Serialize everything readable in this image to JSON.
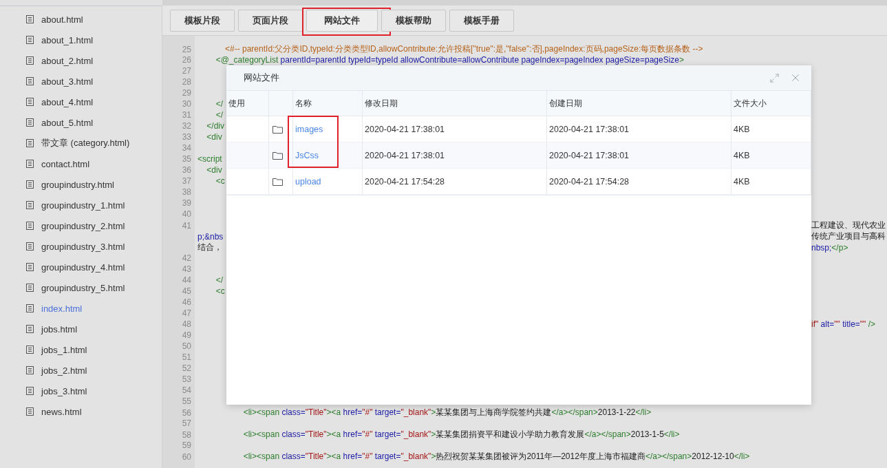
{
  "sidebar": {
    "items": [
      {
        "label": "about.html",
        "selected": false
      },
      {
        "label": "about_1.html",
        "selected": false
      },
      {
        "label": "about_2.html",
        "selected": false
      },
      {
        "label": "about_3.html",
        "selected": false
      },
      {
        "label": "about_4.html",
        "selected": false
      },
      {
        "label": "about_5.html",
        "selected": false
      },
      {
        "label": "带文章 (category.html)",
        "selected": false
      },
      {
        "label": "contact.html",
        "selected": false
      },
      {
        "label": "groupindustry.html",
        "selected": false
      },
      {
        "label": "groupindustry_1.html",
        "selected": false
      },
      {
        "label": "groupindustry_2.html",
        "selected": false
      },
      {
        "label": "groupindustry_3.html",
        "selected": false
      },
      {
        "label": "groupindustry_4.html",
        "selected": false
      },
      {
        "label": "groupindustry_5.html",
        "selected": false
      },
      {
        "label": "index.html",
        "selected": true
      },
      {
        "label": "jobs.html",
        "selected": false
      },
      {
        "label": "jobs_1.html",
        "selected": false
      },
      {
        "label": "jobs_2.html",
        "selected": false
      },
      {
        "label": "jobs_3.html",
        "selected": false
      },
      {
        "label": "news.html",
        "selected": false
      }
    ]
  },
  "toolbar": {
    "buttons": [
      {
        "label": "模板片段",
        "selected": false,
        "outlined": false
      },
      {
        "label": "页面片段",
        "selected": false,
        "outlined": false
      },
      {
        "label": "网站文件",
        "selected": true,
        "outlined": true
      },
      {
        "label": "模板帮助",
        "selected": false,
        "outlined": false
      },
      {
        "label": "模板手册",
        "selected": false,
        "outlined": false
      }
    ]
  },
  "editor": {
    "lines": [
      {
        "number": "25",
        "full": true,
        "segments": [
          {
            "kind": "comment",
            "text": "            <#-- parentId:父分类ID,typeId:分类类型ID,allowContribute:允许投稿[\"true\":是,\"false\":否],pageIndex:页码,pageSize:每页数据条数 -->"
          }
        ]
      },
      {
        "number": "26",
        "full": true,
        "segments": [
          {
            "kind": "tag",
            "text": "        <@_categoryList"
          },
          {
            "kind": "attr",
            "text": " parentId=parentId typeId=typeId allowContribute=allowContribute pageIndex=pageIndex pageSize=pageSize"
          },
          {
            "kind": "tag",
            "text": ">"
          }
        ]
      },
      {
        "number": "27"
      },
      {
        "number": "28"
      },
      {
        "number": "29"
      },
      {
        "number": "30",
        "segments": [
          {
            "kind": "tag",
            "text": "        </"
          }
        ]
      },
      {
        "number": "31",
        "segments": [
          {
            "kind": "tag",
            "text": "        </"
          }
        ]
      },
      {
        "number": "32",
        "segments": [
          {
            "kind": "tag",
            "text": "    </div"
          }
        ]
      },
      {
        "number": "33",
        "segments": [
          {
            "kind": "tag",
            "text": "    <div"
          }
        ]
      },
      {
        "number": "34"
      },
      {
        "number": "35",
        "segments": [
          {
            "kind": "tag",
            "text": "<script"
          }
        ]
      },
      {
        "number": "36",
        "segments": [
          {
            "kind": "tag",
            "text": "    <div"
          }
        ]
      },
      {
        "number": "37",
        "segments": [
          {
            "kind": "tag",
            "text": "        <c"
          }
        ]
      },
      {
        "number": "38"
      },
      {
        "number": "39"
      },
      {
        "number": "40"
      },
      {
        "number": "41",
        "tail": [
          {
            "kind": "text",
            "text": "工程建设、现代农业"
          }
        ]
      },
      {
        "segments": [
          {
            "kind": "attr",
            "text": "p;&nbs"
          }
        ],
        "tail": [
          {
            "kind": "text",
            "text": "传统产业项目与高科"
          }
        ]
      },
      {
        "segments": [
          {
            "kind": "text",
            "text": "结合，"
          }
        ],
        "tail": [
          {
            "kind": "attr",
            "text": "nbsp;"
          },
          {
            "kind": "tag",
            "text": "</p>"
          }
        ]
      },
      {
        "number": "42"
      },
      {
        "number": "43"
      },
      {
        "number": "44",
        "segments": [
          {
            "kind": "tag",
            "text": "        </"
          }
        ]
      },
      {
        "number": "45",
        "segments": [
          {
            "kind": "tag",
            "text": "        <c"
          }
        ]
      },
      {
        "number": "46"
      },
      {
        "number": "47"
      },
      {
        "number": "48",
        "tail": [
          {
            "kind": "value",
            "text": "if\""
          },
          {
            "kind": "attr",
            "text": " alt="
          },
          {
            "kind": "value",
            "text": "\"\""
          },
          {
            "kind": "attr",
            "text": " title="
          },
          {
            "kind": "value",
            "text": "\"\""
          },
          {
            "kind": "tag",
            "text": " />"
          }
        ]
      },
      {
        "number": "49"
      },
      {
        "number": "50"
      },
      {
        "number": "51"
      },
      {
        "number": "52"
      },
      {
        "number": "53"
      },
      {
        "number": "54"
      },
      {
        "number": "55"
      },
      {
        "number": "56",
        "full": true,
        "segments": [
          {
            "kind": "tag",
            "text": "                    <li><span"
          },
          {
            "kind": "attr",
            "text": " class="
          },
          {
            "kind": "value",
            "text": "\"Title\""
          },
          {
            "kind": "tag",
            "text": "><a"
          },
          {
            "kind": "attr",
            "text": " href="
          },
          {
            "kind": "value",
            "text": "\"#\""
          },
          {
            "kind": "attr",
            "text": " target="
          },
          {
            "kind": "value",
            "text": "\"_blank\""
          },
          {
            "kind": "tag",
            "text": ">"
          },
          {
            "kind": "text",
            "text": "某某集团与上海商学院签约共建"
          },
          {
            "kind": "tag",
            "text": "</a></span>"
          },
          {
            "kind": "text",
            "text": "2013-1-22"
          },
          {
            "kind": "tag",
            "text": "</li>"
          }
        ]
      },
      {
        "number": "57"
      },
      {
        "number": "58",
        "full": true,
        "segments": [
          {
            "kind": "tag",
            "text": "                    <li><span"
          },
          {
            "kind": "attr",
            "text": " class="
          },
          {
            "kind": "value",
            "text": "\"Title\""
          },
          {
            "kind": "tag",
            "text": "><a"
          },
          {
            "kind": "attr",
            "text": " href="
          },
          {
            "kind": "value",
            "text": "\"#\""
          },
          {
            "kind": "attr",
            "text": " target="
          },
          {
            "kind": "value",
            "text": "\"_blank\""
          },
          {
            "kind": "tag",
            "text": ">"
          },
          {
            "kind": "text",
            "text": "某某集团捐资平和建设小学助力教育发展"
          },
          {
            "kind": "tag",
            "text": "</a></span>"
          },
          {
            "kind": "text",
            "text": "2013-1-5"
          },
          {
            "kind": "tag",
            "text": "</li>"
          }
        ]
      },
      {
        "number": "59"
      },
      {
        "number": "60",
        "full": true,
        "segments": [
          {
            "kind": "tag",
            "text": "                    <li><span"
          },
          {
            "kind": "attr",
            "text": " class="
          },
          {
            "kind": "value",
            "text": "\"Title\""
          },
          {
            "kind": "tag",
            "text": "><a"
          },
          {
            "kind": "attr",
            "text": " href="
          },
          {
            "kind": "value",
            "text": "\"#\""
          },
          {
            "kind": "attr",
            "text": " target="
          },
          {
            "kind": "value",
            "text": "\"_blank\""
          },
          {
            "kind": "tag",
            "text": ">"
          },
          {
            "kind": "text",
            "text": "热烈祝贺某某集团被评为2011年—2012年度上海市福建商"
          },
          {
            "kind": "tag",
            "text": "</a></span>"
          },
          {
            "kind": "text",
            "text": "2012-12-10"
          },
          {
            "kind": "tag",
            "text": "</li>"
          }
        ]
      }
    ]
  },
  "dialog": {
    "title": "网站文件",
    "columns": [
      "使用",
      "",
      "名称",
      "修改日期",
      "创建日期",
      "文件大小"
    ],
    "rows": [
      {
        "name": "images",
        "modified": "2020-04-21 17:38:01",
        "created": "2020-04-21 17:38:01",
        "size": "4KB",
        "outlined": true
      },
      {
        "name": "JsCss",
        "modified": "2020-04-21 17:38:01",
        "created": "2020-04-21 17:38:01",
        "size": "4KB",
        "outlined": true
      },
      {
        "name": "upload",
        "modified": "2020-04-21 17:54:28",
        "created": "2020-04-21 17:54:28",
        "size": "4KB"
      }
    ]
  }
}
